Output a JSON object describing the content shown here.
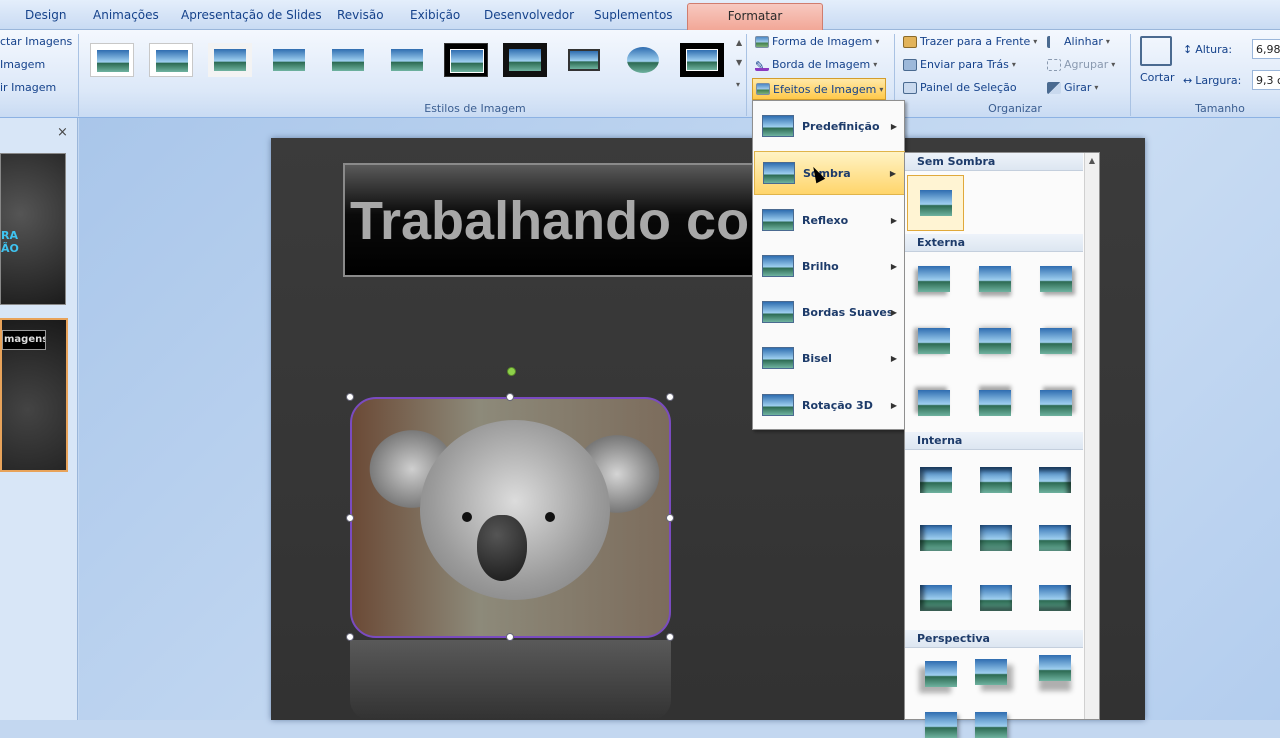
{
  "tabs": {
    "design": "Design",
    "animacoes": "Animações",
    "apresentacao": "Apresentação de Slides",
    "revisao": "Revisão",
    "exibicao": "Exibição",
    "desenvolvedor": "Desenvolvedor",
    "suplementos": "Suplementos",
    "formatar": "Formatar"
  },
  "ribbon": {
    "left_items": [
      "ctar Imagens",
      "Imagem",
      "ir Imagem"
    ],
    "styles_group_label": "Estilos de Imagem",
    "forma": "Forma de Imagem",
    "borda": "Borda de Imagem",
    "efeitos": "Efeitos de Imagem",
    "trazer": "Trazer para a Frente",
    "enviar": "Enviar para Trás",
    "painel": "Painel de Seleção",
    "alinhar": "Alinhar",
    "agrupar": "Agrupar",
    "girar": "Girar",
    "organizar_label": "Organizar",
    "cortar": "Cortar",
    "altura_label": "Altura:",
    "altura_value": "6,98",
    "largura_label": "Largura:",
    "largura_value": "9,3 c",
    "tamanho_label": "Tamanho"
  },
  "left_panel": {
    "close": "×",
    "thumb1_text": "RA\nÃO",
    "thumb2_text": "magens"
  },
  "slide": {
    "title": "Trabalhando co"
  },
  "effects_menu": {
    "items": [
      "Predefinição",
      "Sombra",
      "Reflexo",
      "Brilho",
      "Bordas Suaves",
      "Bisel",
      "Rotação 3D"
    ]
  },
  "gallery": {
    "sem_sombra": "Sem Sombra",
    "externa": "Externa",
    "interna": "Interna",
    "perspectiva": "Perspectiva"
  },
  "colors": {
    "accent_tab": "#f2a797",
    "hover": "#ffd56b"
  }
}
